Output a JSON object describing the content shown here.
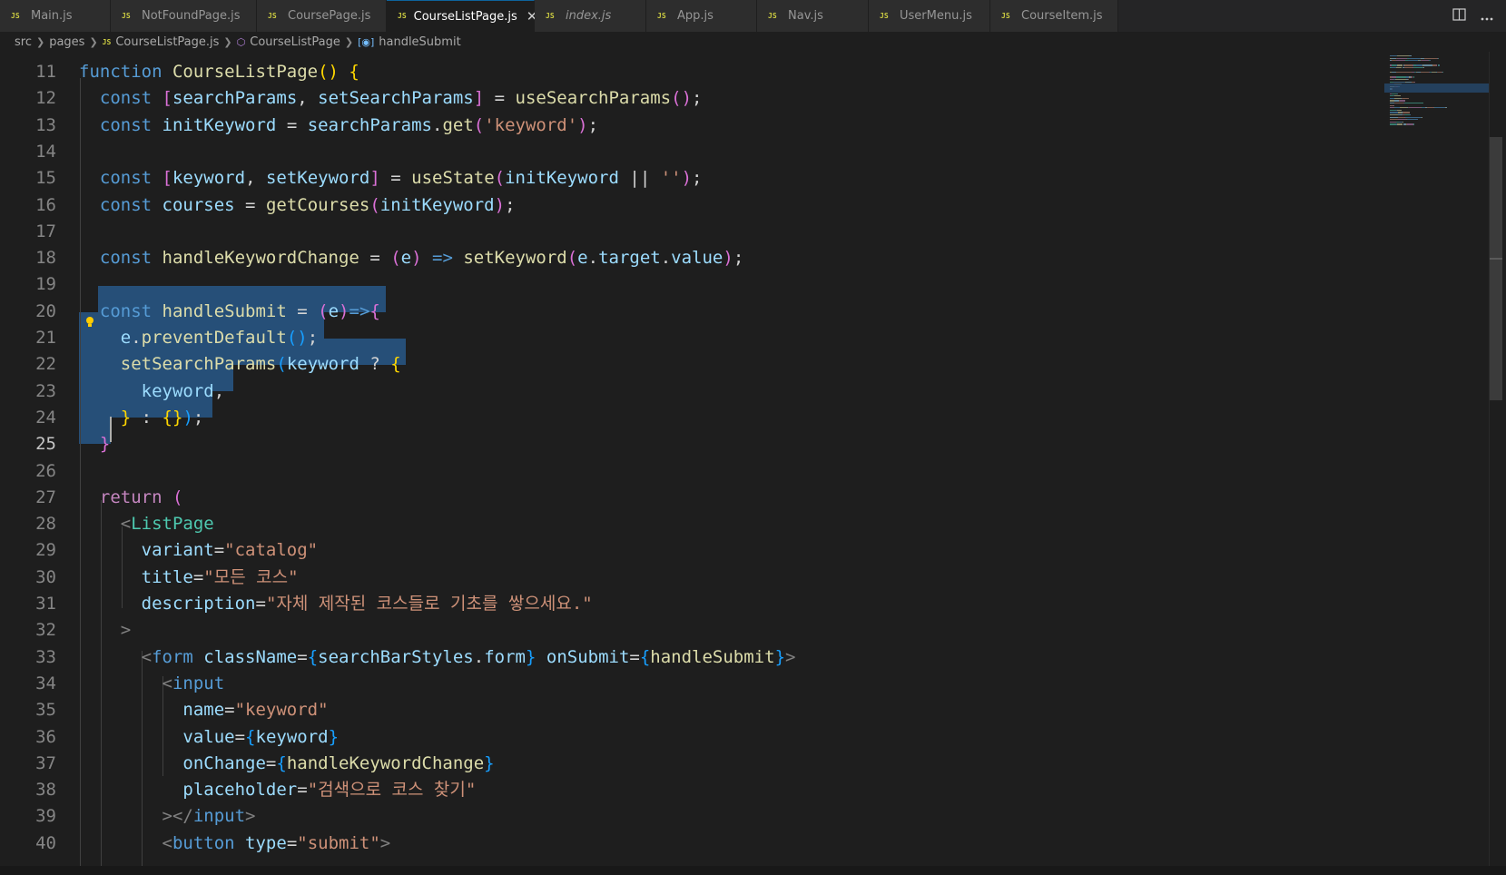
{
  "tabs": [
    {
      "label": "Main.js",
      "active": false,
      "italic": false
    },
    {
      "label": "NotFoundPage.js",
      "active": false,
      "italic": false
    },
    {
      "label": "CoursePage.js",
      "active": false,
      "italic": false
    },
    {
      "label": "CourseListPage.js",
      "active": true,
      "italic": false
    },
    {
      "label": "index.js",
      "active": false,
      "italic": true
    },
    {
      "label": "App.js",
      "active": false,
      "italic": false
    },
    {
      "label": "Nav.js",
      "active": false,
      "italic": false
    },
    {
      "label": "UserMenu.js",
      "active": false,
      "italic": false
    },
    {
      "label": "CourseItem.js",
      "active": false,
      "italic": false
    }
  ],
  "tab_icon_text": "JS",
  "tab_close_glyph": "✕",
  "breadcrumb": {
    "items": [
      "src",
      "pages",
      "CourseListPage.js",
      "CourseListPage",
      "handleSubmit"
    ]
  },
  "editor": {
    "current_line": 25,
    "lines": [
      {
        "n": 11,
        "tokens": [
          [
            "kw",
            "function "
          ],
          [
            "fn",
            "CourseListPage"
          ],
          [
            "b1",
            "() {"
          ]
        ]
      },
      {
        "n": 12,
        "tokens": [
          [
            "pun",
            "  "
          ],
          [
            "kw",
            "const "
          ],
          [
            "b2",
            "["
          ],
          [
            "var",
            "searchParams"
          ],
          [
            "pun",
            ", "
          ],
          [
            "var",
            "setSearchParams"
          ],
          [
            "b2",
            "]"
          ],
          [
            "pun",
            " = "
          ],
          [
            "fn",
            "useSearchParams"
          ],
          [
            "b2",
            "()"
          ],
          [
            "pun",
            ";"
          ]
        ]
      },
      {
        "n": 13,
        "tokens": [
          [
            "pun",
            "  "
          ],
          [
            "kw",
            "const "
          ],
          [
            "var",
            "initKeyword"
          ],
          [
            "pun",
            " = "
          ],
          [
            "var",
            "searchParams"
          ],
          [
            "pun",
            "."
          ],
          [
            "fn",
            "get"
          ],
          [
            "b2",
            "("
          ],
          [
            "str",
            "'keyword'"
          ],
          [
            "b2",
            ")"
          ],
          [
            "pun",
            ";"
          ]
        ]
      },
      {
        "n": 14,
        "tokens": []
      },
      {
        "n": 15,
        "tokens": [
          [
            "pun",
            "  "
          ],
          [
            "kw",
            "const "
          ],
          [
            "b2",
            "["
          ],
          [
            "var",
            "keyword"
          ],
          [
            "pun",
            ", "
          ],
          [
            "var",
            "setKeyword"
          ],
          [
            "b2",
            "]"
          ],
          [
            "pun",
            " = "
          ],
          [
            "fn",
            "useState"
          ],
          [
            "b2",
            "("
          ],
          [
            "var",
            "initKeyword"
          ],
          [
            "pun",
            " || "
          ],
          [
            "str",
            "''"
          ],
          [
            "b2",
            ")"
          ],
          [
            "pun",
            ";"
          ]
        ]
      },
      {
        "n": 16,
        "tokens": [
          [
            "pun",
            "  "
          ],
          [
            "kw",
            "const "
          ],
          [
            "var",
            "courses"
          ],
          [
            "pun",
            " = "
          ],
          [
            "fn",
            "getCourses"
          ],
          [
            "b2",
            "("
          ],
          [
            "var",
            "initKeyword"
          ],
          [
            "b2",
            ")"
          ],
          [
            "pun",
            ";"
          ]
        ]
      },
      {
        "n": 17,
        "tokens": []
      },
      {
        "n": 18,
        "tokens": [
          [
            "pun",
            "  "
          ],
          [
            "kw",
            "const "
          ],
          [
            "fn",
            "handleKeywordChange"
          ],
          [
            "pun",
            " = "
          ],
          [
            "b2",
            "("
          ],
          [
            "var",
            "e"
          ],
          [
            "b2",
            ")"
          ],
          [
            "kw",
            " => "
          ],
          [
            "fn",
            "setKeyword"
          ],
          [
            "b2",
            "("
          ],
          [
            "var",
            "e"
          ],
          [
            "pun",
            "."
          ],
          [
            "var",
            "target"
          ],
          [
            "pun",
            "."
          ],
          [
            "var",
            "value"
          ],
          [
            "b2",
            ")"
          ],
          [
            "pun",
            ";"
          ]
        ]
      },
      {
        "n": 19,
        "tokens": []
      },
      {
        "n": 20,
        "tokens": [
          [
            "pun",
            "  "
          ],
          [
            "kw",
            "const "
          ],
          [
            "fn",
            "handleSubmit"
          ],
          [
            "pun",
            " = "
          ],
          [
            "b2",
            "("
          ],
          [
            "var",
            "e"
          ],
          [
            "b2",
            ")"
          ],
          [
            "kw",
            "=>"
          ],
          [
            "b2",
            "{"
          ]
        ]
      },
      {
        "n": 21,
        "tokens": [
          [
            "pun",
            "    "
          ],
          [
            "var",
            "e"
          ],
          [
            "pun",
            "."
          ],
          [
            "fn",
            "preventDefault"
          ],
          [
            "b3",
            "()"
          ],
          [
            "pun",
            ";"
          ]
        ]
      },
      {
        "n": 22,
        "tokens": [
          [
            "pun",
            "    "
          ],
          [
            "fn",
            "setSearchParams"
          ],
          [
            "b3",
            "("
          ],
          [
            "var",
            "keyword"
          ],
          [
            "pun",
            " ? "
          ],
          [
            "b1",
            "{"
          ]
        ]
      },
      {
        "n": 23,
        "tokens": [
          [
            "pun",
            "      "
          ],
          [
            "var",
            "keyword"
          ],
          [
            "pun",
            ","
          ]
        ]
      },
      {
        "n": 24,
        "tokens": [
          [
            "pun",
            "    "
          ],
          [
            "b1",
            "}"
          ],
          [
            "pun",
            " : "
          ],
          [
            "b1",
            "{}"
          ],
          [
            "b3",
            ")"
          ],
          [
            "pun",
            ";"
          ]
        ]
      },
      {
        "n": 25,
        "tokens": [
          [
            "pun",
            "  "
          ],
          [
            "b2",
            "}"
          ]
        ]
      },
      {
        "n": 26,
        "tokens": []
      },
      {
        "n": 27,
        "tokens": [
          [
            "pun",
            "  "
          ],
          [
            "ctl",
            "return "
          ],
          [
            "b2",
            "("
          ]
        ]
      },
      {
        "n": 28,
        "tokens": [
          [
            "pun",
            "    "
          ],
          [
            "tagp",
            "<"
          ],
          [
            "cmp",
            "ListPage"
          ]
        ]
      },
      {
        "n": 29,
        "tokens": [
          [
            "pun",
            "      "
          ],
          [
            "attr",
            "variant"
          ],
          [
            "pun",
            "="
          ],
          [
            "str",
            "\"catalog\""
          ]
        ]
      },
      {
        "n": 30,
        "tokens": [
          [
            "pun",
            "      "
          ],
          [
            "attr",
            "title"
          ],
          [
            "pun",
            "="
          ],
          [
            "str",
            "\"모든 코스\""
          ]
        ]
      },
      {
        "n": 31,
        "tokens": [
          [
            "pun",
            "      "
          ],
          [
            "attr",
            "description"
          ],
          [
            "pun",
            "="
          ],
          [
            "str",
            "\"자체 제작된 코스들로 기초를 쌓으세요.\""
          ]
        ]
      },
      {
        "n": 32,
        "tokens": [
          [
            "pun",
            "    "
          ],
          [
            "tagp",
            ">"
          ]
        ]
      },
      {
        "n": 33,
        "tokens": [
          [
            "pun",
            "      "
          ],
          [
            "tagp",
            "<"
          ],
          [
            "kw",
            "form "
          ],
          [
            "attr",
            "className"
          ],
          [
            "pun",
            "="
          ],
          [
            "b3",
            "{"
          ],
          [
            "var",
            "searchBarStyles"
          ],
          [
            "pun",
            "."
          ],
          [
            "var",
            "form"
          ],
          [
            "b3",
            "}"
          ],
          [
            "pun",
            " "
          ],
          [
            "attr",
            "onSubmit"
          ],
          [
            "pun",
            "="
          ],
          [
            "b3",
            "{"
          ],
          [
            "fn",
            "handleSubmit"
          ],
          [
            "b3",
            "}"
          ],
          [
            "tagp",
            ">"
          ]
        ]
      },
      {
        "n": 34,
        "tokens": [
          [
            "pun",
            "        "
          ],
          [
            "tagp",
            "<"
          ],
          [
            "kw",
            "input"
          ]
        ]
      },
      {
        "n": 35,
        "tokens": [
          [
            "pun",
            "          "
          ],
          [
            "attr",
            "name"
          ],
          [
            "pun",
            "="
          ],
          [
            "str",
            "\"keyword\""
          ]
        ]
      },
      {
        "n": 36,
        "tokens": [
          [
            "pun",
            "          "
          ],
          [
            "attr",
            "value"
          ],
          [
            "pun",
            "="
          ],
          [
            "b3",
            "{"
          ],
          [
            "var",
            "keyword"
          ],
          [
            "b3",
            "}"
          ]
        ]
      },
      {
        "n": 37,
        "tokens": [
          [
            "pun",
            "          "
          ],
          [
            "attr",
            "onChange"
          ],
          [
            "pun",
            "="
          ],
          [
            "b3",
            "{"
          ],
          [
            "fn",
            "handleKeywordChange"
          ],
          [
            "b3",
            "}"
          ]
        ]
      },
      {
        "n": 38,
        "tokens": [
          [
            "pun",
            "          "
          ],
          [
            "attr",
            "placeholder"
          ],
          [
            "pun",
            "="
          ],
          [
            "str",
            "\"검색으로 코스 찾기\""
          ]
        ]
      },
      {
        "n": 39,
        "tokens": [
          [
            "pun",
            "        "
          ],
          [
            "tagp",
            "></"
          ],
          [
            "kw",
            "input"
          ],
          [
            "tagp",
            ">"
          ]
        ]
      },
      {
        "n": 40,
        "tokens": [
          [
            "pun",
            "        "
          ],
          [
            "tagp",
            "<"
          ],
          [
            "kw",
            "button "
          ],
          [
            "attr",
            "type"
          ],
          [
            "pun",
            "="
          ],
          [
            "str",
            "\"submit\""
          ],
          [
            "tagp",
            ">"
          ]
        ]
      }
    ]
  },
  "colors": {
    "background": "#1e1e1e",
    "selection": "#264f78",
    "tab_active_border": "#0e639c",
    "keyword": "#569cd6",
    "function": "#dcdcaa",
    "variable": "#9cdcfe",
    "string": "#ce9178"
  },
  "icons": [
    "js-file-icon",
    "chevron-right-icon",
    "symbol-class-icon",
    "symbol-variable-icon",
    "lightbulb-icon",
    "close-icon",
    "split-editor-icon",
    "more-actions-icon"
  ]
}
